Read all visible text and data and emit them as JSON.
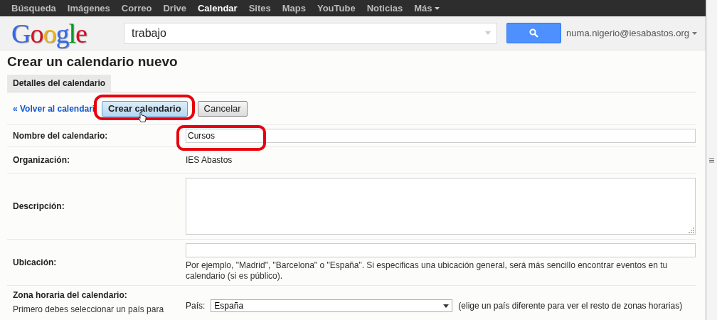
{
  "nav": {
    "items": [
      {
        "label": "Búsqueda",
        "selected": false
      },
      {
        "label": "Imágenes",
        "selected": false
      },
      {
        "label": "Correo",
        "selected": false
      },
      {
        "label": "Drive",
        "selected": false
      },
      {
        "label": "Calendar",
        "selected": true
      },
      {
        "label": "Sites",
        "selected": false
      },
      {
        "label": "Maps",
        "selected": false
      },
      {
        "label": "YouTube",
        "selected": false
      },
      {
        "label": "Noticias",
        "selected": false
      }
    ],
    "more": "Más"
  },
  "logo": "Google",
  "search": {
    "value": "trabajo"
  },
  "account": "numa.nigerio@iesabastos.org",
  "page_title": "Crear un calendario nuevo",
  "tabs": [
    {
      "label": "Detalles del calendario",
      "selected": true
    }
  ],
  "actions": {
    "back_link": "« Volver al calendari",
    "buttons": [
      {
        "label": "Crear calendario",
        "kind": "primary"
      },
      {
        "label": "Cancelar",
        "kind": "secondary"
      }
    ]
  },
  "form": [
    {
      "kind": "input",
      "label": "Nombre del calendario:",
      "value": "Cursos"
    },
    {
      "kind": "text",
      "label": "Organización:",
      "value": "IES Abastos"
    },
    {
      "kind": "textarea",
      "label": "Descripción:"
    },
    {
      "kind": "input",
      "label": "Ubicación:",
      "hint": "Por ejemplo, \"Madrid\", \"Barcelona\" o \"España\". Si especificas una ubicación general, será más sencillo encontrar eventos en tu calendario (si es público)."
    },
    {
      "kind": "select",
      "label": "Zona horaria del calendario:",
      "sublabel": "Primero debes seleccionar un país para",
      "field_label": "País:",
      "value": "España",
      "note": "(elige un país diferente para ver el resto de zonas horarias)"
    }
  ]
}
